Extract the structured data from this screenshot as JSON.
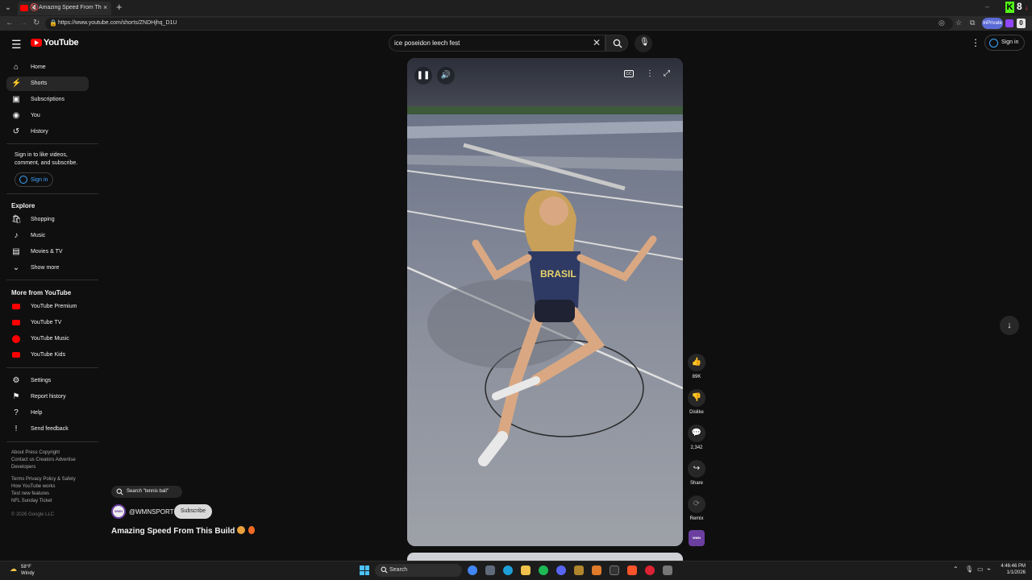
{
  "browser": {
    "tab_title": "Amazing Speed From This Bui",
    "url": "https://www.youtube.com/shorts/ZNDHjhq_D1U",
    "inprivate_label": "InPrivate",
    "kick_count": "8",
    "ext_badge": "0"
  },
  "header": {
    "logo_text": "YouTube",
    "search_value": "ice poseidon leech fest",
    "sign_in": "Sign in"
  },
  "sidebar": {
    "main": [
      {
        "label": "Home",
        "icon": "home-icon"
      },
      {
        "label": "Shorts",
        "icon": "shorts-icon"
      },
      {
        "label": "Subscriptions",
        "icon": "subscriptions-icon"
      },
      {
        "label": "You",
        "icon": "you-icon"
      },
      {
        "label": "History",
        "icon": "history-icon"
      }
    ],
    "signin_note": "Sign in to like videos, comment, and subscribe.",
    "signin_button": "Sign in",
    "explore_heading": "Explore",
    "explore": [
      {
        "label": "Shopping",
        "icon": "shopping-icon"
      },
      {
        "label": "Music",
        "icon": "music-icon"
      },
      {
        "label": "Movies & TV",
        "icon": "movies-icon"
      },
      {
        "label": "Show more",
        "icon": "chevron-down-icon"
      }
    ],
    "more_heading": "More from YouTube",
    "more": [
      {
        "label": "YouTube Premium",
        "icon": "youtube-premium-icon"
      },
      {
        "label": "YouTube TV",
        "icon": "youtube-tv-icon"
      },
      {
        "label": "YouTube Music",
        "icon": "youtube-music-icon"
      },
      {
        "label": "YouTube Kids",
        "icon": "youtube-kids-icon"
      }
    ],
    "settings": [
      {
        "label": "Settings",
        "icon": "gear-icon"
      },
      {
        "label": "Report history",
        "icon": "flag-icon"
      },
      {
        "label": "Help",
        "icon": "help-icon"
      },
      {
        "label": "Send feedback",
        "icon": "feedback-icon"
      }
    ],
    "footer": {
      "line1": "About  Press  Copyright",
      "line2": "Contact us  Creators  Advertise",
      "line3": "Developers",
      "line4": "Terms  Privacy  Policy & Safety",
      "line5": "How YouTube works",
      "line6": "Test new features",
      "line7": "NFL Sunday Ticket",
      "copyright": "© 2026 Google LLC"
    }
  },
  "short": {
    "search_chip": "Search \"tennis ball\"",
    "channel": "@WMNSPORT",
    "avatar_text": "WMN",
    "subscribe": "Subscribe",
    "title": "Amazing Speed From This Build",
    "shirt_text": "BRASIL"
  },
  "actions": {
    "likes": "89K",
    "dislike": "Dislike",
    "comments": "2,342",
    "share": "Share",
    "remix": "Remix"
  },
  "taskbar": {
    "temp": "58°F",
    "condition": "Windy",
    "search": "Search",
    "time": "4:46:46 PM",
    "date": "1/1/2026"
  },
  "colors": {
    "brand_red": "#ff0000",
    "accent_blue": "#3ea6ff",
    "background": "#0f0f0f"
  }
}
